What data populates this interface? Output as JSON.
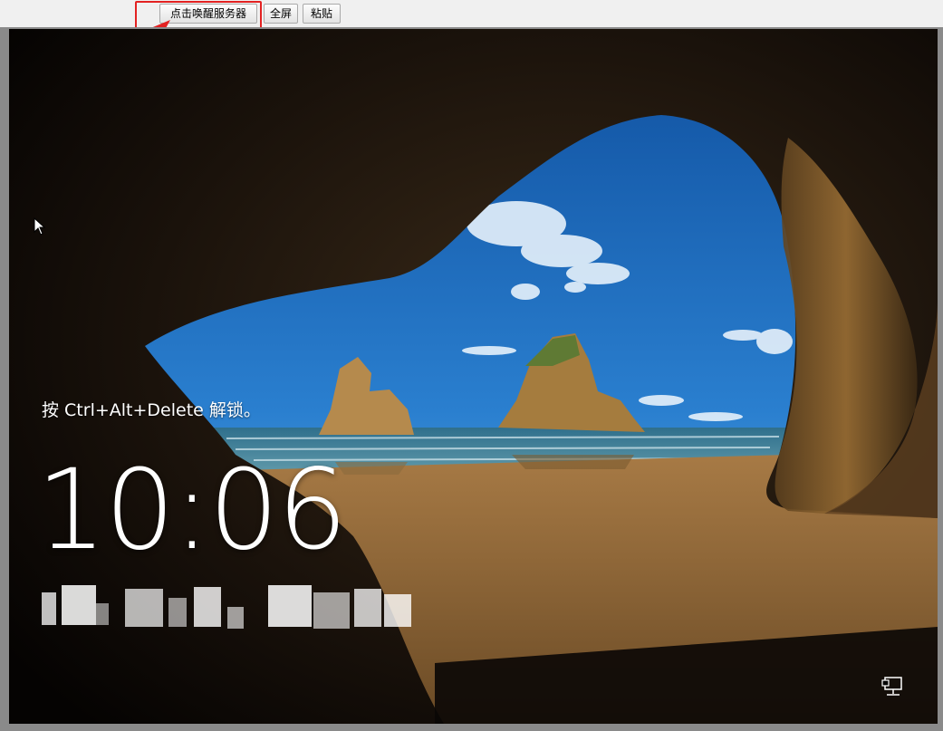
{
  "toolbar": {
    "wake_label": "点击唤醒服务器",
    "fullscreen_label": "全屏",
    "paste_label": "粘贴"
  },
  "lockscreen": {
    "unlock_hint": "按 Ctrl+Alt+Delete 解锁。",
    "time": "10:06",
    "date": ""
  },
  "icons": {
    "cursor": "mouse-cursor-icon",
    "network": "network-icon",
    "annotation_arrow": "red-arrow-icon"
  },
  "colors": {
    "annotation_red": "#e32222",
    "toolbar_bg": "#f0f0f0"
  }
}
